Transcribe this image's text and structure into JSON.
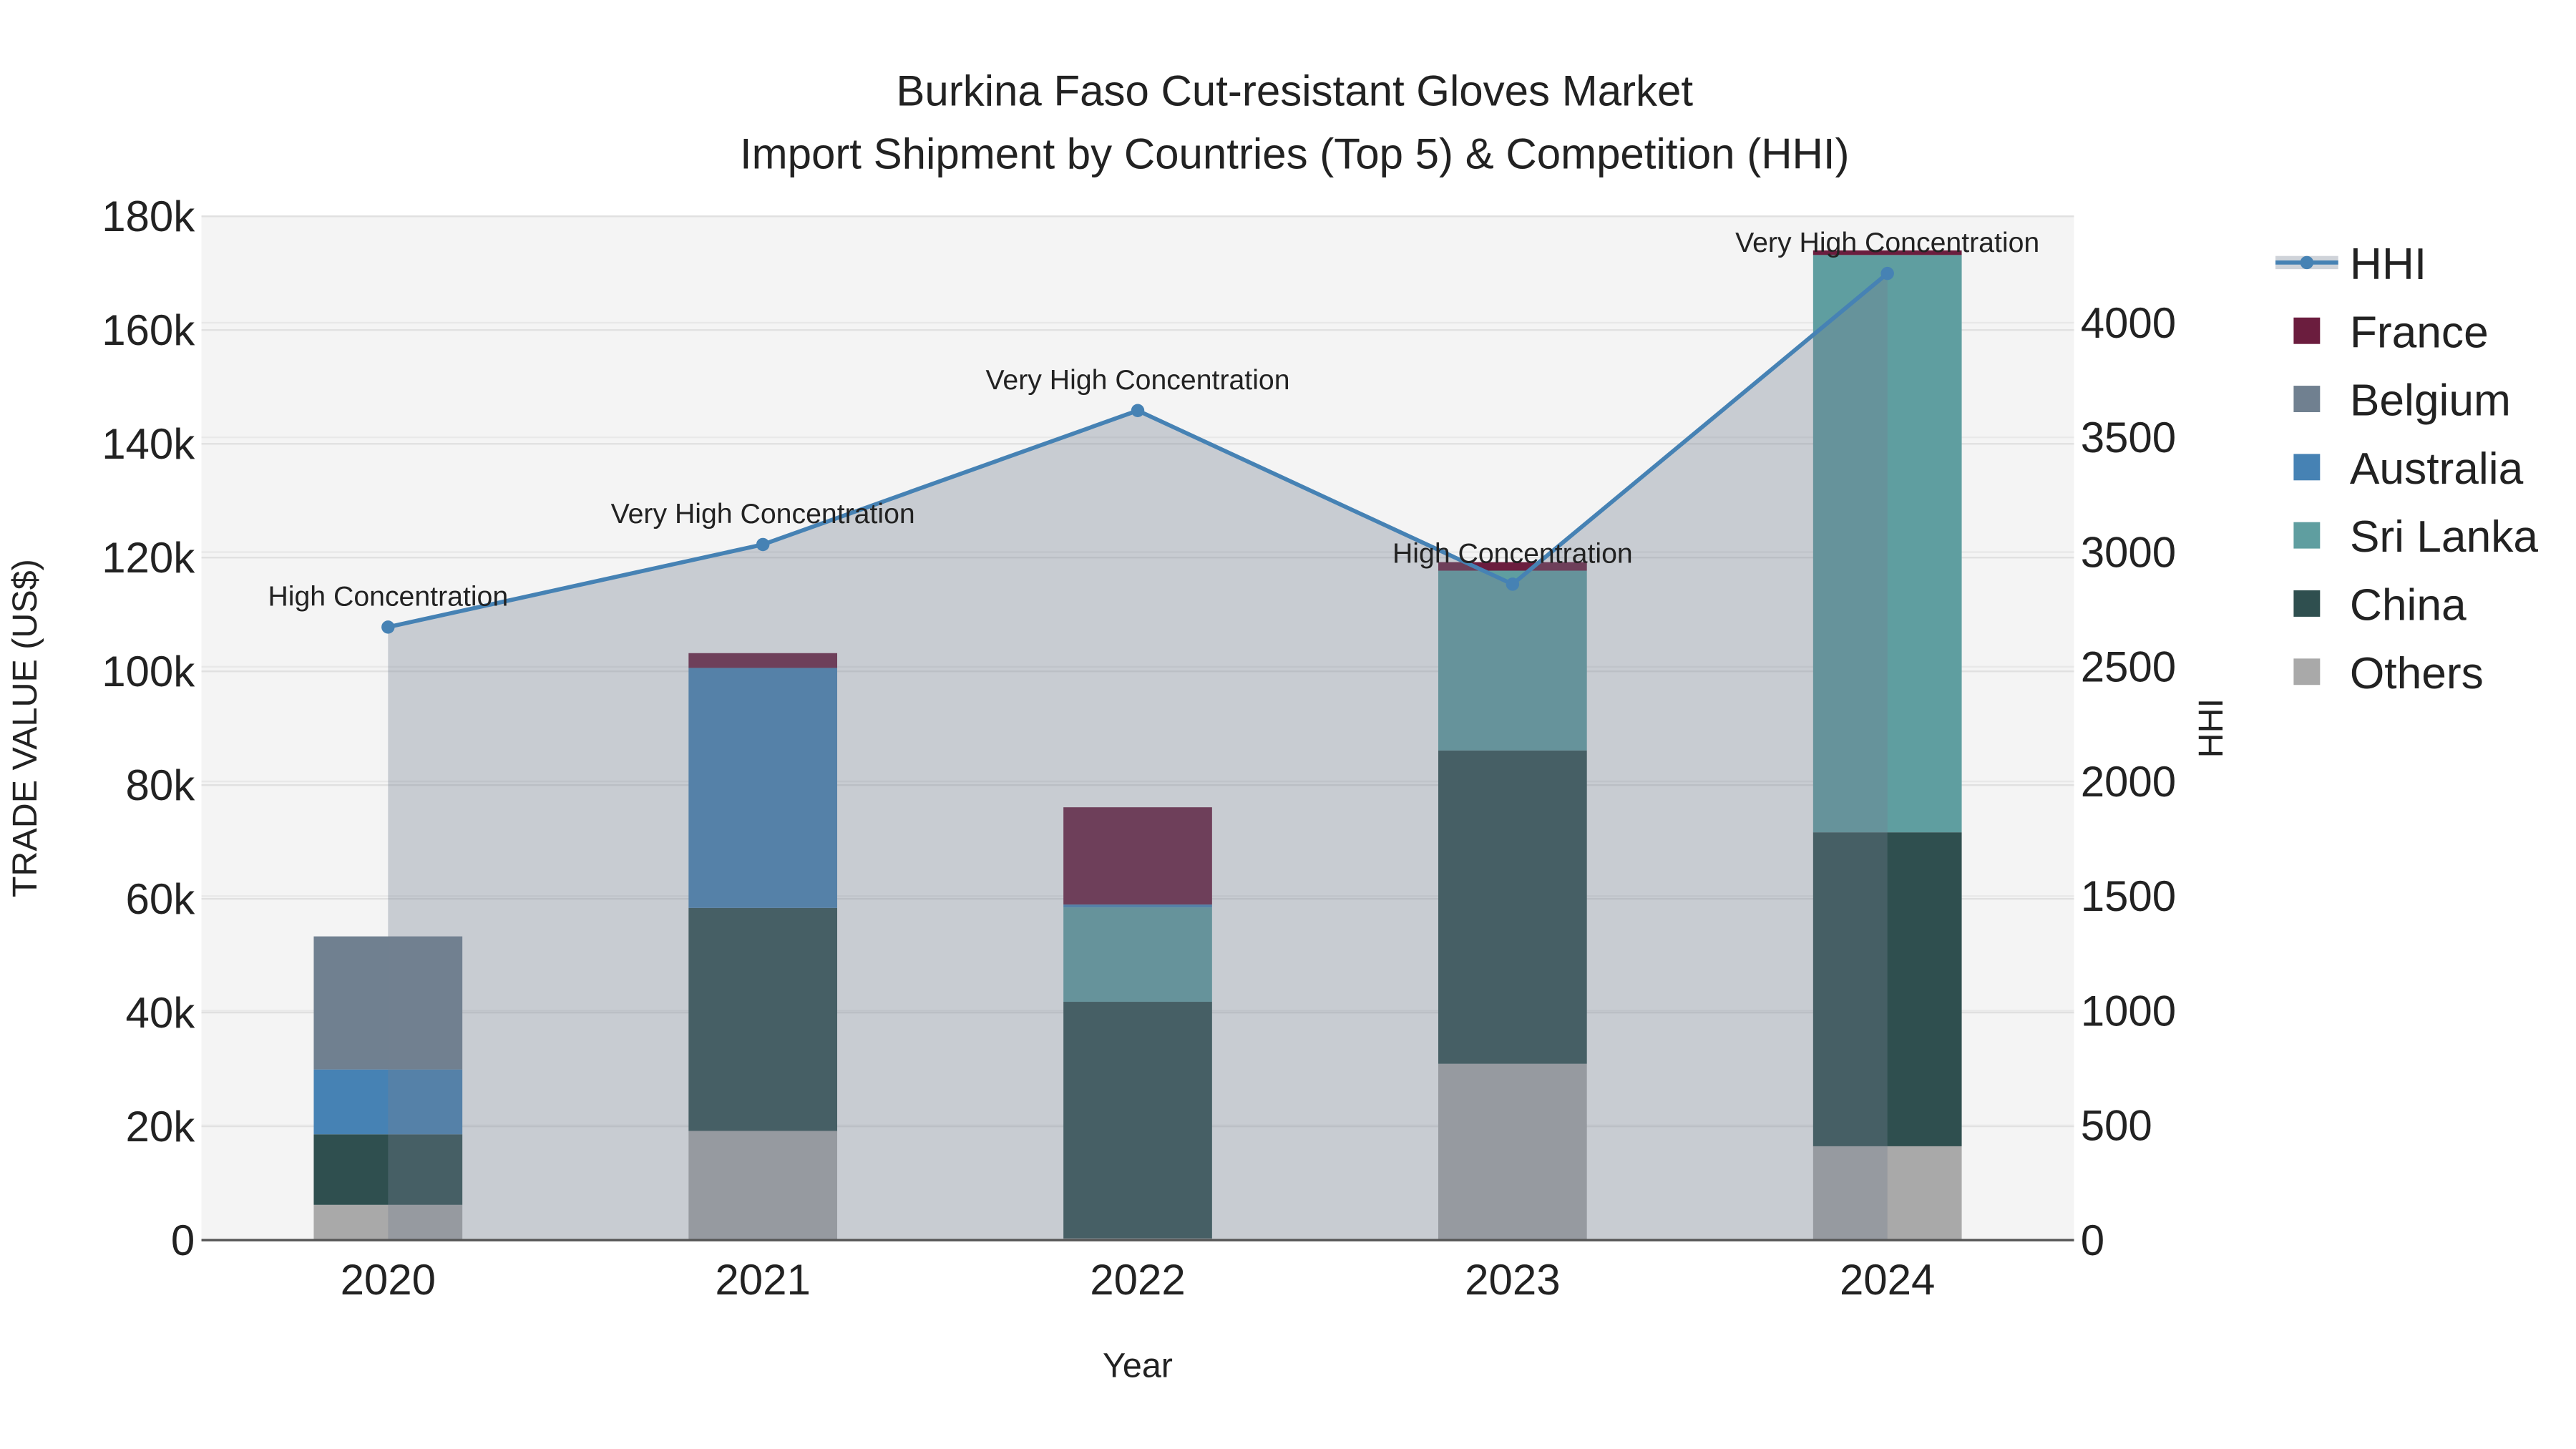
{
  "chart_data": {
    "type": "bar",
    "title_line1": "Burkina Faso Cut-resistant Gloves Market",
    "title_line2": "Import Shipment by Countries (Top 5) & Competition (HHI)",
    "xlabel": "Year",
    "ylabel": "TRADE VALUE (US$)",
    "y2label": "HHI",
    "categories": [
      "2020",
      "2021",
      "2022",
      "2023",
      "2024"
    ],
    "ylim": [
      0,
      180000
    ],
    "y2lim": [
      0,
      4464
    ],
    "yticks": [
      0,
      20000,
      40000,
      60000,
      80000,
      100000,
      120000,
      140000,
      160000,
      180000
    ],
    "ytick_labels": [
      "0",
      "20k",
      "40k",
      "60k",
      "80k",
      "100k",
      "120k",
      "140k",
      "160k",
      "180k"
    ],
    "y2ticks": [
      0,
      500,
      1000,
      1500,
      2000,
      2500,
      3000,
      3500,
      4000
    ],
    "y2tick_labels": [
      "0",
      "500",
      "1000",
      "1500",
      "2000",
      "2500",
      "3000",
      "3500",
      "4000"
    ],
    "series": [
      {
        "name": "Others",
        "color": "#a9a9a9",
        "values": [
          6200,
          19200,
          300,
          31000,
          16500
        ]
      },
      {
        "name": "China",
        "color": "#2f4f4f",
        "values": [
          12400,
          39200,
          41600,
          55100,
          55200
        ]
      },
      {
        "name": "Sri Lanka",
        "color": "#5f9ea0",
        "values": [
          0,
          0,
          16600,
          31600,
          101500
        ]
      },
      {
        "name": "Australia",
        "color": "#4682b4",
        "values": [
          11400,
          42200,
          500,
          0,
          0
        ]
      },
      {
        "name": "Belgium",
        "color": "#708090",
        "values": [
          23400,
          0,
          0,
          0,
          0
        ]
      },
      {
        "name": "France",
        "color": "#6b1d3e",
        "values": [
          0,
          2600,
          17100,
          1500,
          800
        ]
      }
    ],
    "hhi": {
      "name": "HHI",
      "color": "#4682b4",
      "values": [
        2673,
        3033,
        3617,
        2860,
        4215
      ]
    },
    "annotations": [
      "High Concentration",
      "Very High Concentration",
      "Very High Concentration",
      "High Concentration",
      "Very High Concentration"
    ],
    "legend": [
      "HHI",
      "France",
      "Belgium",
      "Australia",
      "Sri Lanka",
      "China",
      "Others"
    ],
    "legend_position": "right",
    "grid": true
  }
}
